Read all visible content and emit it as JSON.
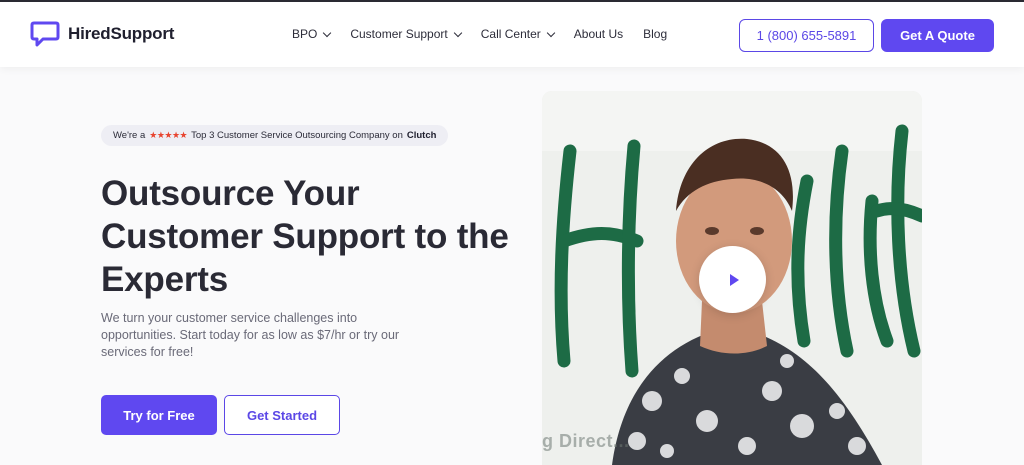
{
  "header": {
    "brand": "HiredSupport",
    "nav": [
      {
        "label": "BPO",
        "dropdown": true
      },
      {
        "label": "Customer Support",
        "dropdown": true
      },
      {
        "label": "Call Center",
        "dropdown": true
      },
      {
        "label": "About Us",
        "dropdown": false
      },
      {
        "label": "Blog",
        "dropdown": false
      }
    ],
    "phone": "1 (800) 655-5891",
    "quote_label": "Get A Quote"
  },
  "hero": {
    "badge_prefix": "We're a",
    "badge_stars": "★★★★★",
    "badge_text": "Top 3 Customer Service Outsourcing Company on",
    "badge_brand": "Clutch",
    "title": "Outsource Your Customer Support to the Experts",
    "description": "We turn your customer service challenges into opportunities. Start today for as low as $7/hr or try our services for free!",
    "try_label": "Try for Free",
    "start_label": "Get Started"
  },
  "video": {
    "caption": "g Direct..."
  },
  "colors": {
    "accent": "#5f48f0",
    "star": "#e8442f",
    "wall_script": "#1d6b45"
  },
  "icons": {
    "logo": "chat-bubble-icon",
    "play": "play-icon"
  }
}
